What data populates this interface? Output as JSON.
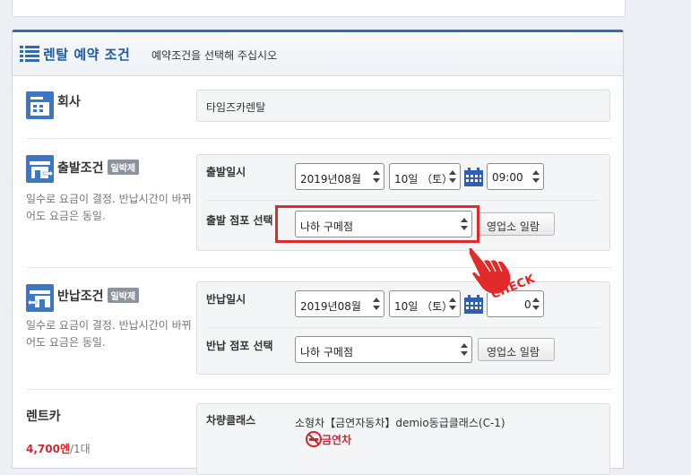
{
  "header": {
    "title": "렌탈 예약 조건",
    "subtitle": "예약조건을 선택해 주십시오"
  },
  "company": {
    "label": "회사",
    "value": "타임즈카렌탈"
  },
  "departure": {
    "title": "출발조건",
    "badge": "일박제",
    "desc": "일수로 요금이 결정. 반납시간이 바뀌어도 요금은 동일.",
    "date_label": "출발일시",
    "month": "2019년08월",
    "day": "10일 （토）",
    "time": "09:00",
    "store_label": "출발 점포 선택",
    "store": "나하 구메점",
    "store_button": "영업소 일람"
  },
  "return": {
    "title": "반납조건",
    "badge": "일박제",
    "desc": "일수로 요금이 결정. 반납시간이 바뀌어도 요금은 동일.",
    "date_label": "반납일시",
    "month": "2019년08월",
    "day": "10일 （토）",
    "time": "0",
    "store_label": "반납 점포 선택",
    "store": "나하 구메점",
    "store_button": "영업소 일람"
  },
  "rentcar": {
    "title": "렌트카",
    "price": "4,700엔",
    "unit": "/1대",
    "class_label": "차량클래스",
    "class_value": "소형차【금연자동차】demio동급클래스(C-1)",
    "nonsmoking": "금연차"
  },
  "annotation": {
    "check": "CHECK"
  },
  "colors": {
    "accent": "#2e6bb8",
    "highlight": "#e22a2a",
    "icon": "#3b77c4"
  }
}
